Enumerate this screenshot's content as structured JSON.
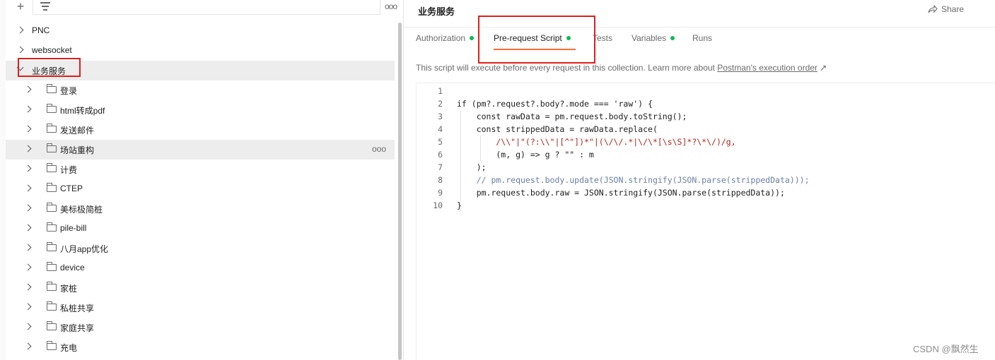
{
  "sidebar": {
    "top_rows": [
      {
        "label": "PNC",
        "expanded": false
      },
      {
        "label": "websocket",
        "expanded": false
      },
      {
        "label": "业务服务",
        "expanded": true
      }
    ],
    "folders": [
      "登录",
      "html转成pdf",
      "发送邮件",
      "场站重构",
      "计费",
      "CTEP",
      "美标极简桩",
      "pile-bill",
      "八月app优化",
      "device",
      "家桩",
      "私桩共享",
      "家庭共享",
      "充电"
    ],
    "more_glyph": "ooo"
  },
  "collection": {
    "title": "业务服务",
    "share_label": "Share"
  },
  "tabs": [
    {
      "label": "Authorization",
      "dot": true
    },
    {
      "label": "Pre-request Script",
      "dot": true,
      "active": true
    },
    {
      "label": "Tests",
      "dot": false
    },
    {
      "label": "Variables",
      "dot": true
    },
    {
      "label": "Runs",
      "dot": false
    }
  ],
  "description": {
    "text": "This script will execute before every request in this collection. Learn more about ",
    "link": "Postman's execution order",
    "link_arrow": "↗"
  },
  "code": {
    "line_numbers": [
      "1",
      "2",
      "3",
      "4",
      "5",
      "6",
      "7",
      "8",
      "9",
      "10"
    ],
    "lines": [
      "",
      "if (pm?.request?.body?.mode === 'raw') {",
      "    const rawData = pm.request.body.toString();",
      "    const strippedData = rawData.replace(",
      "        /\\\\\"|\"(?:\\\\\"|[^\"])*\"|(\\/\\/.*|\\/\\*[\\s\\S]*?\\*\\/)/g,",
      "        (m, g) => g ? \"\" : m",
      "    );",
      "    // pm.request.body.update(JSON.stringify(JSON.parse(strippedData)));",
      "    pm.request.body.raw = JSON.stringify(JSON.parse(strippedData));",
      "}"
    ]
  },
  "watermark": "CSDN @飘然生",
  "colors": {
    "highlight_box": "#e01e1e",
    "active_underline": "#ff6c37",
    "status_dot": "#0cbb52"
  }
}
